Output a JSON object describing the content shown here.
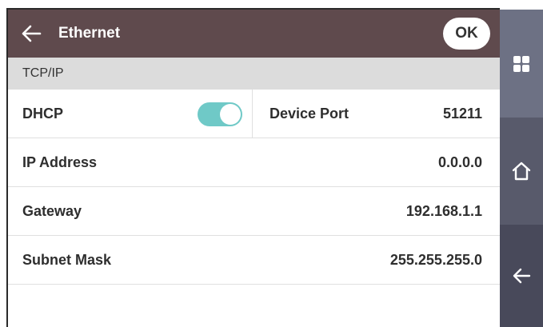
{
  "header": {
    "title": "Ethernet",
    "ok_label": "OK"
  },
  "section": {
    "title": "TCP/IP"
  },
  "settings": {
    "dhcp": {
      "label": "DHCP",
      "enabled": true
    },
    "device_port": {
      "label": "Device Port",
      "value": "51211"
    },
    "ip_address": {
      "label": "IP Address",
      "value": "0.0.0.0"
    },
    "gateway": {
      "label": "Gateway",
      "value": "192.168.1.1"
    },
    "subnet_mask": {
      "label": "Subnet Mask",
      "value": "255.255.255.0"
    }
  },
  "colors": {
    "header_bg": "#5f4a4d",
    "section_bg": "#dcdcdc",
    "toggle_on": "#6fc9c7",
    "nav_top": "#6d7184",
    "nav_middle": "#585a6b",
    "nav_bottom": "#48495a"
  },
  "icons": {
    "header_back": "arrow-left-icon",
    "apps": "apps-grid-icon",
    "home": "home-icon",
    "nav_back": "arrow-left-icon"
  }
}
